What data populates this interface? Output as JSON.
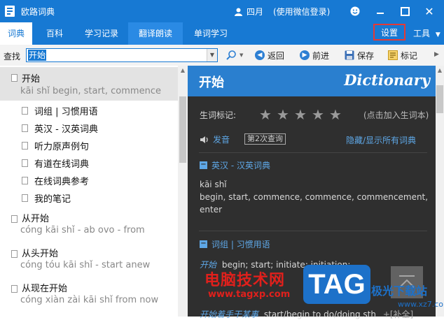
{
  "titlebar": {
    "title": "欧路词典",
    "user": "四月",
    "login_status": "(使用微信登录)",
    "buttons": [
      "smiley-icon",
      "minimize-icon",
      "maximize-icon",
      "close-icon"
    ]
  },
  "nav": {
    "tabs": [
      "词典",
      "百科",
      "学习记录",
      "翻译朗读",
      "单词学习"
    ],
    "settings": "设置",
    "tools": "工具"
  },
  "search": {
    "label": "查找",
    "value": "开始",
    "back": "返回",
    "forward": "前进",
    "save": "保存",
    "mark": "标记"
  },
  "results": [
    {
      "word": "开始",
      "pinyin": "kāi shǐ   begin, start, commence"
    },
    {
      "word": "从开始",
      "pinyin": "cóng kāi shǐ   - ab ovo  - from"
    },
    {
      "word": "从头开始",
      "pinyin": "cóng tóu kāi shǐ   - start anew"
    },
    {
      "word": "从现在开始",
      "pinyin": "cóng xiàn zài kāi shǐ   from now"
    }
  ],
  "sub_dicts": [
    "词组 | 习惯用语",
    "英汉 - 汉英词典",
    "听力原声例句",
    "有道在线词典",
    "在线词典参考",
    "我的笔记"
  ],
  "detail": {
    "headword": "开始",
    "brand": "Dictionary",
    "tag_label": "生词标记:",
    "add_hint": "(点击加入生词本)",
    "pronounce": "发音",
    "query_count": "第2次查询",
    "toggle_all": "隐藏/显示所有词典",
    "section1_title": "英汉 - 汉英词典",
    "section1_pinyin": "kāi shǐ",
    "section1_def_line1": "begin, start, commence, commence, commencement,",
    "section1_def_line2": "enter",
    "section2_title": "词组 | 习惯用语",
    "section2_line1_word": "开始",
    "section2_line1_def": "begin; start; initiate; initiation;",
    "section2_line2_word": "开始",
    "section2_line2_word_b": "着手干某事",
    "section2_line2_def": "start/begin to do/doing sth",
    "section2_line2_extra": "+[补全]"
  },
  "watermark": {
    "text_red": "电脑技术网",
    "url": "www.tagxp.com",
    "logo": "TAG",
    "right_text": "极光下载站",
    "right_url": "www.xz7.com"
  },
  "colors": {
    "brand_blue": "#1779d3",
    "detail_bg": "#2f2f2f",
    "section_blue": "#5ea7e6",
    "highlight_red": "#e53935"
  }
}
